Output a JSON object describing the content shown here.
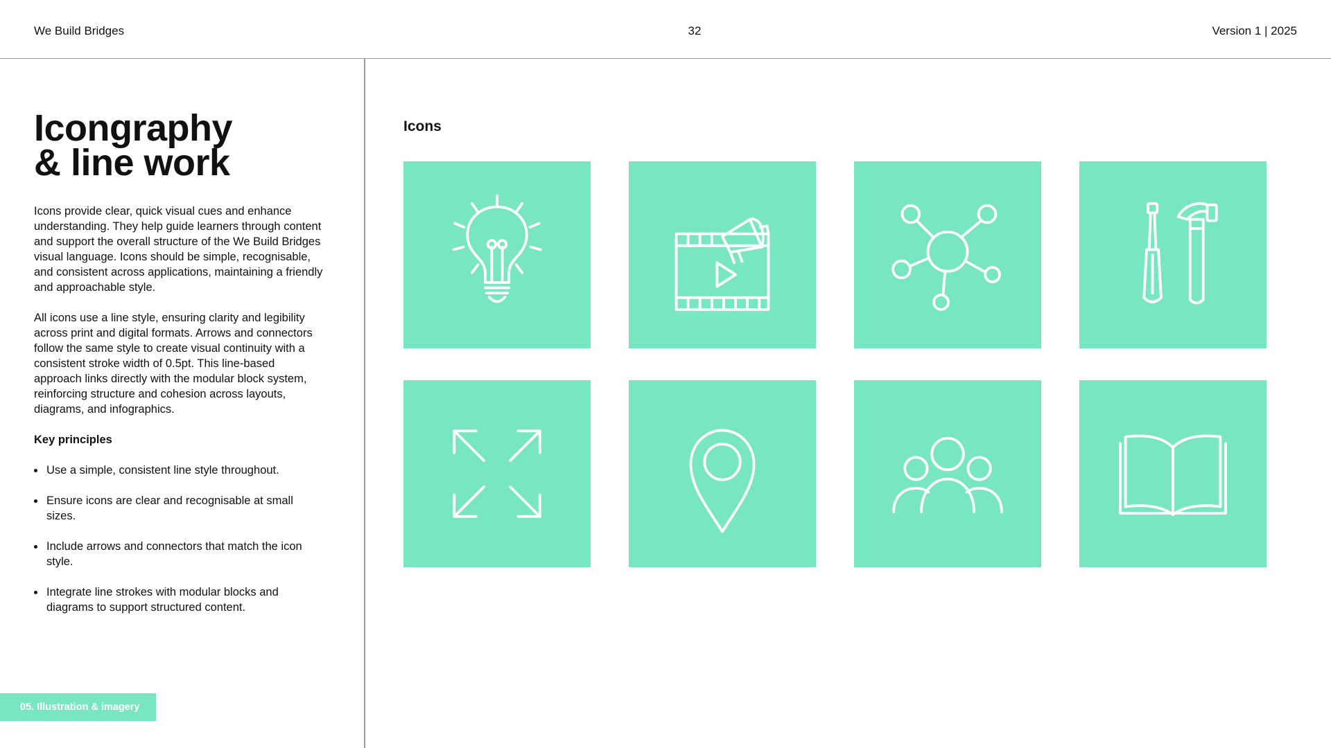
{
  "header": {
    "brand": "We Build Bridges",
    "page_number": "32",
    "version": "Version 1 | 2025"
  },
  "left": {
    "title_line1": "Icongraphy",
    "title_line2": "& line work",
    "paragraph1": "Icons provide clear, quick visual cues and enhance understanding. They help guide learners through content and support the overall structure of the We Build Bridges visual language. Icons should be simple, recognisable, and consistent across applications, maintaining a friendly and approachable style.",
    "paragraph2": "All icons use a line style, ensuring clarity and legibility across print and digital formats. Arrows and connectors follow the same style to create visual continuity with a consistent stroke width of 0.5pt. This line-based approach links directly with the modular block system, reinforcing structure and cohesion across layouts, diagrams, and infographics.",
    "key_principles_title": "Key principles",
    "principles": [
      "Use a simple, consistent line style throughout.",
      "Ensure icons are clear and recognisable at small sizes.",
      "Include arrows and connectors that match the icon style.",
      "Integrate line strokes with modular blocks and diagrams to support structured content."
    ],
    "section_tag": "05. Illustration & imagery"
  },
  "right": {
    "icons_label": "Icons",
    "icons": [
      "lightbulb-icon",
      "video-megaphone-icon",
      "network-icon",
      "tools-icon",
      "expand-arrows-icon",
      "location-pin-icon",
      "people-group-icon",
      "open-book-icon"
    ]
  },
  "colors": {
    "accent": "#78e6c1",
    "text": "#111111",
    "divider": "#9a9a9a",
    "background": "#ffffff"
  }
}
